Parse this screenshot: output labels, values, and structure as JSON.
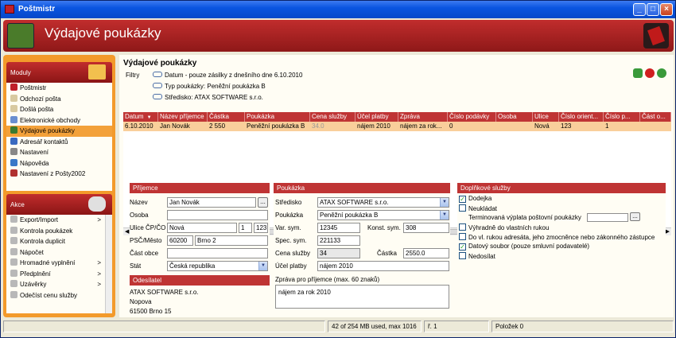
{
  "window": {
    "title": "Poštmistr"
  },
  "banner": {
    "title": "Výdajové poukázky"
  },
  "sidebar": {
    "modules_title": "Moduly",
    "modules": [
      {
        "label": "Poštmistr",
        "icon": "postmistr-icon",
        "color": "#c0202a"
      },
      {
        "label": "Odchozí pošta",
        "icon": "outgoing-mail-icon",
        "color": "#d8c9a0"
      },
      {
        "label": "Došlá pošta",
        "icon": "incoming-mail-icon",
        "color": "#d8c9a0"
      },
      {
        "label": "Elektronické obchody",
        "icon": "eshop-icon",
        "color": "#6a8fd0"
      },
      {
        "label": "Výdajové poukázky",
        "icon": "payment-order-icon",
        "color": "#3a7a30",
        "selected": true
      },
      {
        "label": "Adresář kontaktů",
        "icon": "address-book-icon",
        "color": "#3a6ac0"
      },
      {
        "label": "Nastavení",
        "icon": "settings-icon",
        "color": "#888888"
      },
      {
        "label": "Nápověda",
        "icon": "help-icon",
        "color": "#3a78c8"
      },
      {
        "label": "Nastavení z Pošty2002",
        "icon": "import-settings-icon",
        "color": "#b03030"
      }
    ],
    "actions_title": "Akce",
    "actions": [
      {
        "label": "Export/Import",
        "arrow": ">"
      },
      {
        "label": "Kontrola poukázek",
        "arrow": ""
      },
      {
        "label": "Kontrola duplicit",
        "arrow": ""
      },
      {
        "label": "Nápočet",
        "arrow": ""
      },
      {
        "label": "Hromadné vyplnění",
        "arrow": ">"
      },
      {
        "label": "Předplnění",
        "arrow": ">"
      },
      {
        "label": "Uzávěrky",
        "arrow": ">"
      },
      {
        "label": "Odečíst cenu služby",
        "arrow": ""
      }
    ]
  },
  "main": {
    "title": "Výdajové poukázky",
    "filters_label": "Filtry",
    "filters": [
      "Datum - pouze zásilky z dnešního dne 6.10.2010",
      "Typ poukázky: Peněžní poukázka  B",
      "Středisko: ATAX SOFTWARE s.r.o."
    ],
    "toolbar": {
      "refresh_color": "#3a9a3a",
      "stop_color": "#d02020",
      "go_color": "#3a9a3a"
    }
  },
  "grid": {
    "columns": [
      "Datum",
      "Název příjemce",
      "Částka",
      "Poukázka",
      "Cena služby",
      "Účel platby",
      "Zpráva",
      "Číslo podávky",
      "Osoba",
      "Ulice",
      "Číslo orient...",
      "Číslo p...",
      "Část o..."
    ],
    "sort_indicator": "▼",
    "rows": [
      [
        "6.10.2010",
        "Jan Novák",
        "2 550",
        "Peněžní poukázka  B",
        "34.0",
        "nájem 2010",
        "nájem za rok...",
        "0",
        "",
        "Nová",
        "123",
        "1",
        ""
      ]
    ]
  },
  "recipient": {
    "header": "Příjemce",
    "name_label": "Název",
    "name": "Jan Novák",
    "name_btn": "...",
    "person_label": "Osoba",
    "person": "",
    "street_label": "Ulice ČP/ČO",
    "street": "Nová",
    "cp": "1",
    "co": "123",
    "zip_label": "PSČ/Město",
    "zip": "60200",
    "city": "Brno 2",
    "district_label": "Část obce",
    "district": "",
    "country_label": "Stát",
    "country": "Česká republika"
  },
  "sender": {
    "header": "Odesílatel",
    "lines": [
      "ATAX SOFTWARE s.r.o.",
      "Nopova",
      "61500 Brno 15"
    ]
  },
  "voucher": {
    "header": "Poukázka",
    "center_label": "Středisko",
    "center": "ATAX SOFTWARE s.r.o.",
    "type_label": "Poukázka",
    "type": "Peněžní poukázka  B",
    "vs_label": "Var. sym.",
    "vs": "12345",
    "ks_label": "Konst. sym.",
    "ks": "308",
    "ss_label": "Spec. sym.",
    "ss": "221133",
    "fee_label": "Cena služby",
    "fee": "34",
    "amount_label": "Částka",
    "amount": "2550.0",
    "purpose_label": "Účel platby",
    "purpose": "nájem 2010",
    "message_label": "Zpráva pro příjemce (max. 60 znaků)",
    "message": "nájem za rok 2010"
  },
  "services": {
    "header": "Doplňkové služby",
    "items": [
      {
        "label": "Dodejka",
        "checked": true
      },
      {
        "label": "Neukládat",
        "checked": false
      },
      {
        "label": "Terminovaná výplata poštovní poukázky",
        "checked": null
      },
      {
        "label": "Výhradně do vlastních rukou",
        "checked": false
      },
      {
        "label": "Do vl. rukou adresáta, jeho zmocněnce nebo zákonného zástupce",
        "checked": false
      },
      {
        "label": "Datový soubor (pouze smluvní podavatelé)",
        "checked": true
      },
      {
        "label": "Nedosílat",
        "checked": false
      }
    ],
    "term_btn": "..."
  },
  "status": {
    "memory": "42 of 254 MB used, max 1016",
    "row": "ř. 1",
    "items": "Položek 0"
  }
}
